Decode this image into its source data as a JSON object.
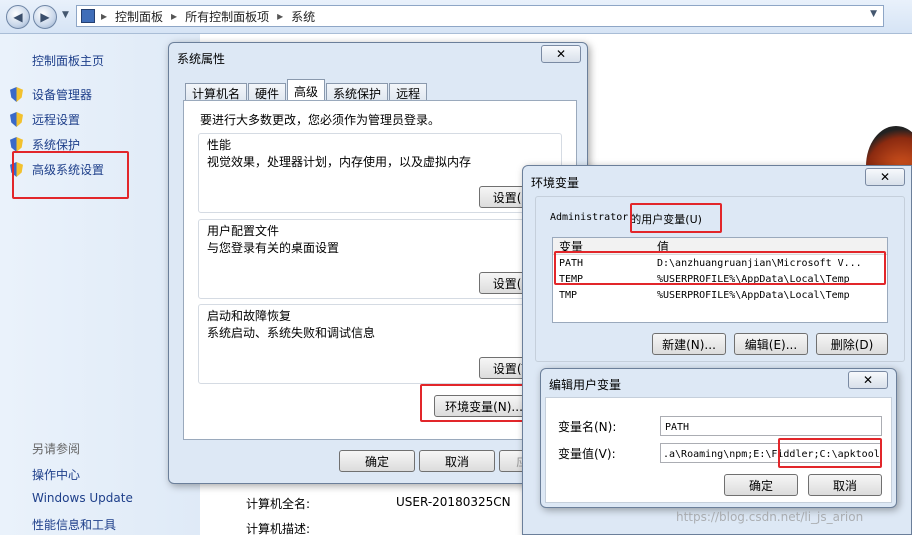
{
  "explorer": {
    "breadcrumb": [
      "控制面板",
      "所有控制面板项",
      "系统"
    ],
    "sidebar": {
      "home": "控制面板主页",
      "items": [
        "设备管理器",
        "远程设置",
        "系统保护",
        "高级系统设置"
      ],
      "see_also_label": "另请参阅",
      "see_also": [
        "操作中心",
        "Windows Update",
        "性能信息和工具"
      ]
    },
    "computer_info": {
      "full_name_label": "计算机全名:",
      "full_name_value": "USER-20180325CN",
      "desc_label": "计算机描述:"
    }
  },
  "sysprops": {
    "title": "系统属性",
    "close": "✕",
    "tabs": [
      "计算机名",
      "硬件",
      "高级",
      "系统保护",
      "远程"
    ],
    "active_tab": "高级",
    "admin_note": "要进行大多数更改，您必须作为管理员登录。",
    "groups": [
      {
        "title": "性能",
        "desc": "视觉效果，处理器计划，内存使用，以及虚拟内存",
        "button": "设置(S)..."
      },
      {
        "title": "用户配置文件",
        "desc": "与您登录有关的桌面设置",
        "button": "设置(E)..."
      },
      {
        "title": "启动和故障恢复",
        "desc": "系统启动、系统失败和调试信息",
        "button": "设置(T)..."
      }
    ],
    "env_button": "环境变量(N)...",
    "ok": "确定",
    "cancel": "取消",
    "apply": "应用(A)"
  },
  "envvars": {
    "title": "环境变量",
    "close": "✕",
    "user_label_prefix": "Administrator",
    "user_label_suffix": "的用户变量(U)",
    "columns": [
      "变量",
      "值"
    ],
    "rows": [
      {
        "name": "PATH",
        "value": "D:\\anzhuangruanjian\\Microsoft V..."
      },
      {
        "name": "TEMP",
        "value": "%USERPROFILE%\\AppData\\Local\\Temp"
      },
      {
        "name": "TMP",
        "value": "%USERPROFILE%\\AppData\\Local\\Temp"
      }
    ],
    "new": "新建(N)...",
    "edit": "编辑(E)...",
    "delete": "删除(D)"
  },
  "edituser": {
    "title": "编辑用户变量",
    "close": "✕",
    "name_label": "变量名(N):",
    "name_value": "PATH",
    "value_label": "变量值(V):",
    "value_value": ".a\\Roaming\\npm;E:\\Fiddler;C:\\apktool",
    "ok": "确定",
    "cancel": "取消"
  },
  "watermark": "https://blog.csdn.net/li_js_arion",
  "colors": {
    "highlight_box": "#e2262a",
    "link": "#1e3f8a"
  }
}
